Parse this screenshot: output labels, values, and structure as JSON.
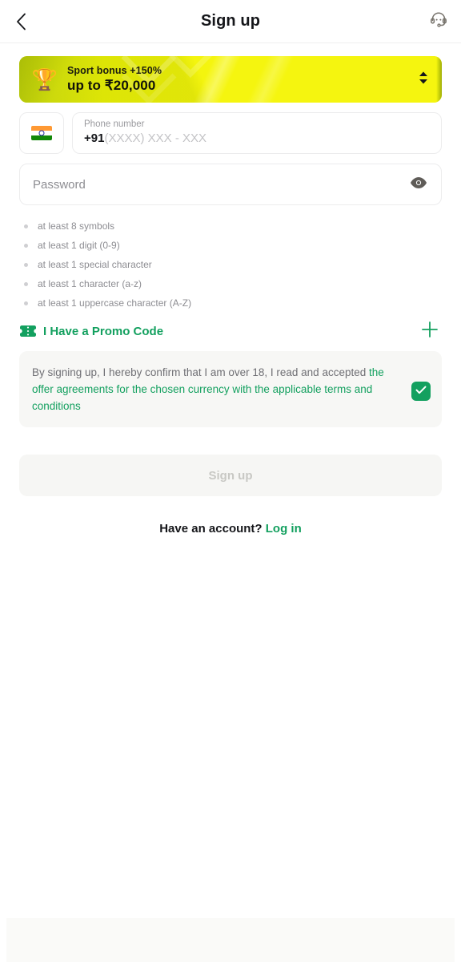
{
  "header": {
    "title": "Sign up",
    "back_icon": "chevron-left-icon",
    "support_icon": "headset-support-icon"
  },
  "banner": {
    "icon": "trophy-emoji",
    "subtitle": "Sport bonus +150%",
    "title": "up to ₹20,000",
    "expand_icon": "chevron-up-down-icon",
    "background_color": "#f5f50f"
  },
  "phone": {
    "country_flag": "india-flag-icon",
    "label": "Phone number",
    "code": "+91",
    "mask": "(XXXX) XXX - XXX"
  },
  "password": {
    "placeholder": "Password",
    "toggle_icon": "eye-icon"
  },
  "password_rules": [
    "at least 8 symbols",
    "at least 1 digit (0-9)",
    "at least 1 special character",
    "at least 1 character (a-z)",
    "at least 1 uppercase character (A-Z)"
  ],
  "promo": {
    "icon": "ticket-icon",
    "label": "I Have a Promo Code",
    "add_icon": "plus-icon",
    "color": "#13a05f"
  },
  "consent": {
    "text_plain": "By signing up, I hereby confirm that I am over 18, I read and accepted ",
    "text_link": "the offer agreements for the chosen currency with the applicable terms and conditions",
    "checked": true,
    "check_icon": "checkmark-icon",
    "accent_color": "#13a05f"
  },
  "submit": {
    "label": "Sign up",
    "disabled": true
  },
  "login": {
    "question": "Have an account?",
    "link": "Log in"
  }
}
